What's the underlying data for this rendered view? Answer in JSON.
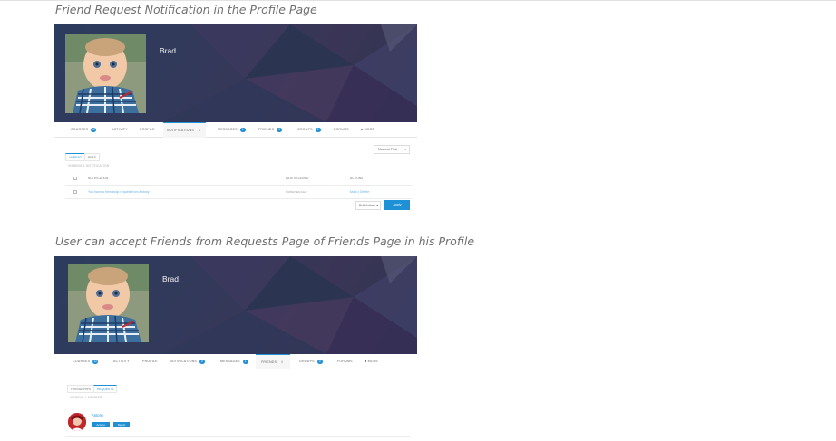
{
  "captions": {
    "notifications": "Friend Request Notification in the Profile Page",
    "friends": "User can accept Friends from Requests Page of Friends Page in his Profile"
  },
  "profile": {
    "name": "Brad"
  },
  "nav1": {
    "courses": "COURSES",
    "courses_count": "12",
    "activity": "ACTIVITY",
    "profile": "PROFILE",
    "notifications": "NOTIFICATIONS",
    "notifications_count": "1",
    "messages": "MESSAGES",
    "messages_count": "1",
    "friends": "FRIENDS",
    "friends_count": "0",
    "groups": "GROUPS",
    "groups_count": "0",
    "forums": "FORUMS",
    "more": "MORE"
  },
  "nav2": {
    "courses": "COURSES",
    "courses_count": "12",
    "activity": "ACTIVITY",
    "profile": "PROFILE",
    "notifications": "NOTIFICATIONS",
    "notifications_count": "0",
    "messages": "MESSAGES",
    "messages_count": "1",
    "friends": "FRIENDS",
    "friends_count": "0",
    "groups": "GROUPS",
    "groups_count": "0",
    "forums": "FORUMS",
    "more": "MORE"
  },
  "notif_page": {
    "tab_unread": "UNREAD",
    "tab_read": "READ",
    "sort": "Newest First",
    "viewing": "VIEWING 1 NOTIFICATION",
    "col_notification": "NOTIFICATION",
    "col_date": "DATE RECEIVED",
    "col_actions": "ACTIONS",
    "row_text": "You have a friendship request from Antony",
    "row_date": "6 MINUTES AGO",
    "row_actions": "Mark | Delete",
    "bulk": "Bulk Actions",
    "apply": "Apply"
  },
  "friends_page": {
    "tab_friendships": "FRIENDSHIPS",
    "tab_requests": "REQUESTS",
    "viewing": "VIEWING 1 MEMBER",
    "member_name": "Antony",
    "accept": "Accept",
    "reject": "Reject"
  },
  "colors": {
    "accent": "#1e90d6",
    "cover": "#2f3656"
  }
}
